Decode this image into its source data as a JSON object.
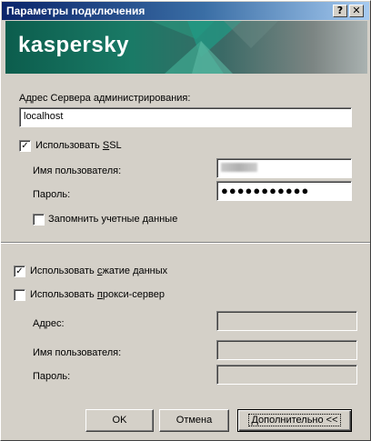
{
  "window": {
    "title": "Параметры подключения",
    "help_btn": "?",
    "close_btn": "✕"
  },
  "banner": {
    "logo_text": "kaspersky"
  },
  "server": {
    "label": "Адрес Сервера администрирования:",
    "value": "localhost"
  },
  "ssl": {
    "checked": true,
    "label_pre": "Использовать ",
    "label_ul": "S",
    "label_post": "SL",
    "username_label": "Имя пользователя:",
    "password_label": "Пароль:",
    "password_value": "●●●●●●●●●●●",
    "remember_label": "Запомнить учетные данные",
    "remember_checked": false
  },
  "compression": {
    "checked": true,
    "label_pre": "Использовать ",
    "label_ul": "с",
    "label_post": "жатие данных"
  },
  "proxy": {
    "checked": false,
    "label_pre": "Использовать ",
    "label_ul": "п",
    "label_post": "рокси-сервер",
    "address_label": "Адрес:",
    "username_label": "Имя пользователя:",
    "password_label": "Пароль:"
  },
  "buttons": {
    "ok": "OK",
    "cancel": "Отмена",
    "advanced": "Дополнительно <<"
  },
  "colors": {
    "title_start": "#0a246a",
    "title_end": "#a6caf0",
    "dialog_bg": "#d4d0c8",
    "banner_green": "#0c5d4d"
  }
}
